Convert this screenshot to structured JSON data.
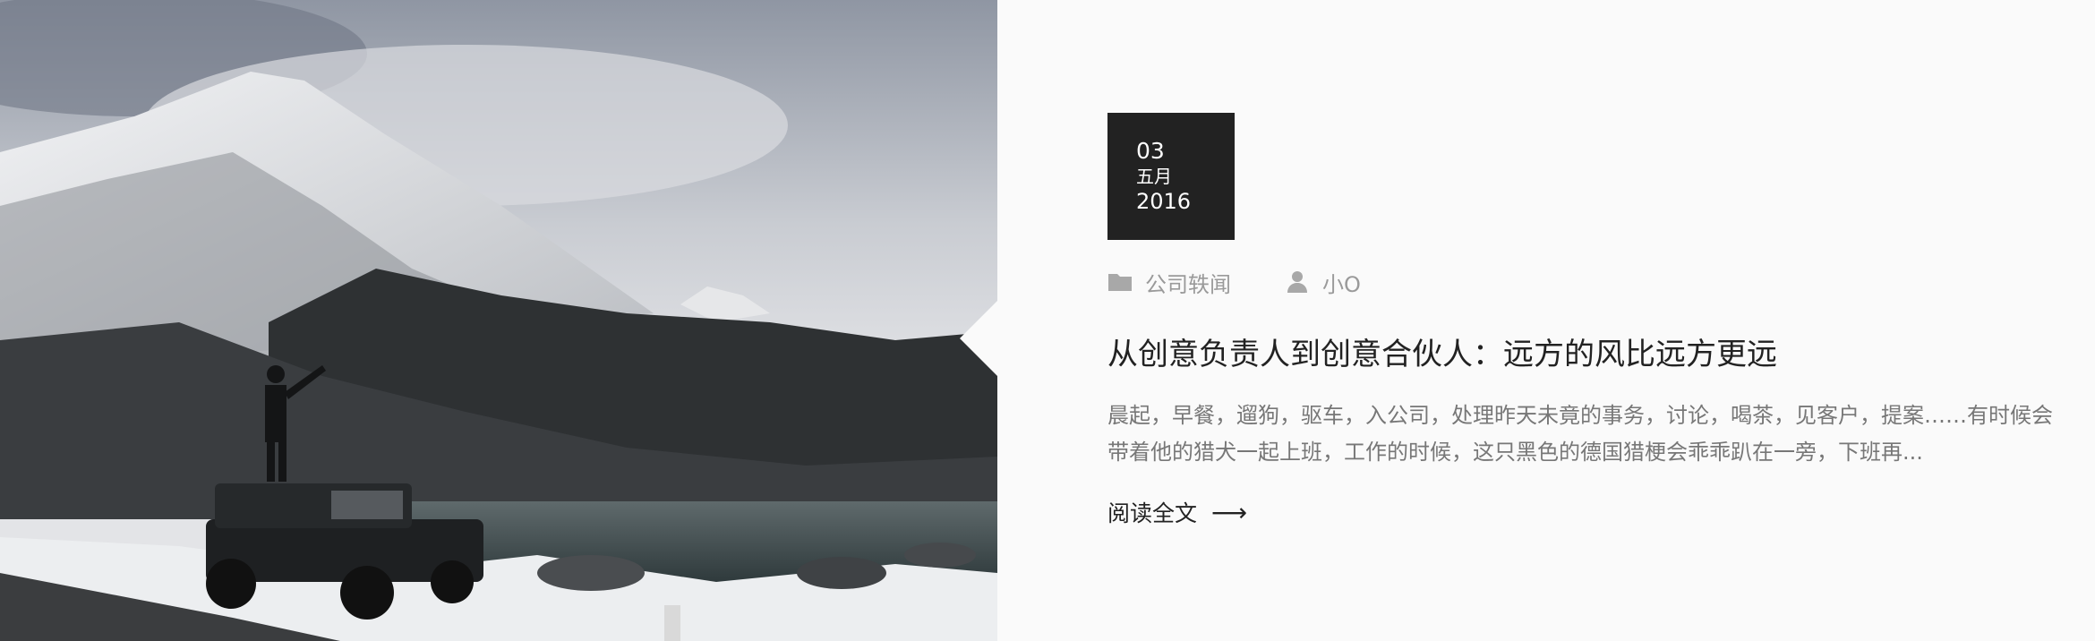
{
  "post": {
    "date": {
      "day": "03",
      "month": "五月",
      "year": "2016"
    },
    "category": "公司轶闻",
    "author": "小O",
    "title": "从创意负责人到创意合伙人：远方的风比远方更远",
    "excerpt": "晨起，早餐，遛狗，驱车，入公司，处理昨天未竟的事务，讨论，喝茶，见客户，提案……有时候会带着他的猎犬一起上班，工作的时候，这只黑色的德国猎梗会乖乖趴在一旁，下班再...",
    "read_more": "阅读全文",
    "read_more_arrow": "⟶"
  },
  "icons": {
    "category": "folder-icon",
    "author": "user-icon"
  },
  "colors": {
    "background": "#fafafa",
    "date_box": "#222222",
    "meta": "#9a9a9a",
    "title": "#222222",
    "excerpt": "#777777"
  }
}
